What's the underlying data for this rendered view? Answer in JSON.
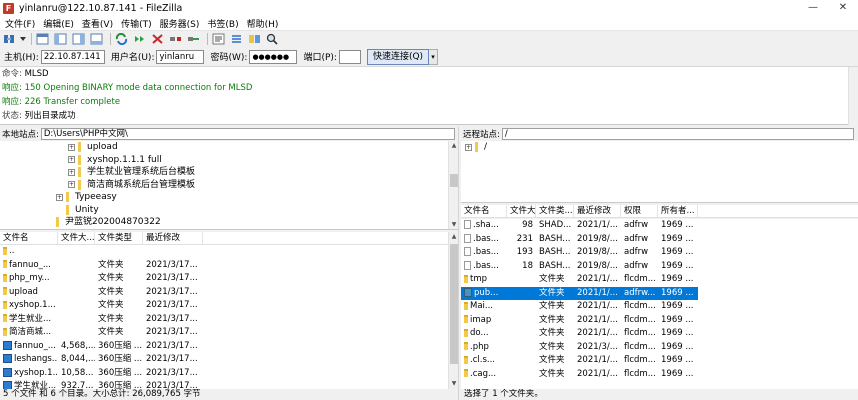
{
  "window": {
    "title": "yinlanru@122.10.87.141 - FileZilla",
    "app_icon_letter": "F",
    "controls": {
      "minimize": "—",
      "close": "✕"
    }
  },
  "menu": [
    "文件(F)",
    "编辑(E)",
    "查看(V)",
    "传输(T)",
    "服务器(S)",
    "书签(B)",
    "帮助(H)"
  ],
  "quickconnect": {
    "host_label": "主机(H):",
    "host_value": "22.10.87.141",
    "user_label": "用户名(U):",
    "user_value": "yinlanru",
    "pass_label": "密码(W):",
    "pass_value": "●●●●●●",
    "port_label": "端口(P):",
    "port_value": "",
    "button": "快速连接(Q)",
    "dropdown": "▾"
  },
  "log": [
    {
      "prefix": "命令:",
      "text": "MLSD",
      "color": "black"
    },
    {
      "prefix": "响应:",
      "text": "150 Opening BINARY mode data connection for MLSD",
      "color": "green"
    },
    {
      "prefix": "响应:",
      "text": "226 Transfer complete",
      "color": "green"
    },
    {
      "prefix": "状态:",
      "text": "列出目录成功",
      "color": "black"
    }
  ],
  "local": {
    "site_label": "本地站点:",
    "site_path": "D:\\Users\\PHP中文网\\",
    "tree": [
      {
        "label": "upload",
        "expander": "+"
      },
      {
        "label": "xyshop.1.1.1 full",
        "expander": "+"
      },
      {
        "label": "学生就业管理系统后台模板",
        "expander": "+"
      },
      {
        "label": "简洁商城系统后台管理模板",
        "expander": "+"
      },
      {
        "label": "Typeeasy",
        "expander": "+"
      },
      {
        "label": "Unity",
        "expander": ""
      },
      {
        "label": "尹蓝锐202004870322",
        "expander": ""
      }
    ],
    "columns": [
      "文件名",
      "文件大...",
      "文件类型",
      "最近修改"
    ],
    "rows": [
      {
        "icon": "fold",
        "name": "..",
        "size": "",
        "type": "",
        "modified": ""
      },
      {
        "icon": "fold",
        "name": "fannuo_...",
        "size": "",
        "type": "文件夹",
        "modified": "2021/3/17..."
      },
      {
        "icon": "fold",
        "name": "php_my...",
        "size": "",
        "type": "文件夹",
        "modified": "2021/3/17..."
      },
      {
        "icon": "fold",
        "name": "upload",
        "size": "",
        "type": "文件夹",
        "modified": "2021/3/17..."
      },
      {
        "icon": "fold",
        "name": "xyshop.1...",
        "size": "",
        "type": "文件夹",
        "modified": "2021/3/17..."
      },
      {
        "icon": "fold",
        "name": "学生就业...",
        "size": "",
        "type": "文件夹",
        "modified": "2021/3/17..."
      },
      {
        "icon": "fold",
        "name": "简洁商城...",
        "size": "",
        "type": "文件夹",
        "modified": "2021/3/17..."
      },
      {
        "icon": "zip",
        "name": "fannuo_...",
        "size": "4,568,...",
        "type": "360压缩 ...",
        "modified": "2021/3/17..."
      },
      {
        "icon": "zip",
        "name": "leshangs...",
        "size": "8,044,...",
        "type": "360压缩 ...",
        "modified": "2021/3/17..."
      },
      {
        "icon": "zip",
        "name": "xyshop.1...",
        "size": "10,58...",
        "type": "360压缩 ...",
        "modified": "2021/3/17..."
      },
      {
        "icon": "zip",
        "name": "学生就业...",
        "size": "932.7...",
        "type": "360压缩 ...",
        "modified": "2021/3/17..."
      }
    ],
    "status": "5 个文件 和 6 个目录。大小总计: 26,089,765 字节"
  },
  "remote": {
    "site_label": "远程站点:",
    "site_path": "/",
    "tree": [
      {
        "label": "/",
        "expander": "+"
      }
    ],
    "columns": [
      "文件名",
      "文件大...",
      "文件类...",
      "最近修改",
      "权限",
      "所有者..."
    ],
    "rows": [
      {
        "icon": "file",
        "name": ".sha...",
        "size": "98",
        "type": "SHAD...",
        "modified": "2021/1/...",
        "perms": "adfrw",
        "owner": "1969 ...",
        "selected": false
      },
      {
        "icon": "file",
        "name": ".bas...",
        "size": "231",
        "type": "BASH...",
        "modified": "2019/8/...",
        "perms": "adfrw",
        "owner": "1969 ...",
        "selected": false
      },
      {
        "icon": "file",
        "name": ".bas...",
        "size": "193",
        "type": "BASH...",
        "modified": "2019/8/...",
        "perms": "adfrw",
        "owner": "1969 ...",
        "selected": false
      },
      {
        "icon": "file",
        "name": ".bas...",
        "size": "18",
        "type": "BASH...",
        "modified": "2019/8/...",
        "perms": "adfrw",
        "owner": "1969 ...",
        "selected": false
      },
      {
        "icon": "fold",
        "name": "tmp",
        "size": "",
        "type": "文件夹",
        "modified": "2021/1/...",
        "perms": "flcdm...",
        "owner": "1969 ...",
        "selected": false
      },
      {
        "icon": "link",
        "name": "pub...",
        "size": "",
        "type": "文件夹",
        "modified": "2021/1/...",
        "perms": "adfrw...",
        "owner": "1969 ...",
        "selected": true
      },
      {
        "icon": "fold",
        "name": "Mai...",
        "size": "",
        "type": "文件夹",
        "modified": "2021/1/...",
        "perms": "flcdm...",
        "owner": "1969 ...",
        "selected": false
      },
      {
        "icon": "fold",
        "name": "imap",
        "size": "",
        "type": "文件夹",
        "modified": "2021/1/...",
        "perms": "flcdm...",
        "owner": "1969 ...",
        "selected": false
      },
      {
        "icon": "fold",
        "name": "do...",
        "size": "",
        "type": "文件夹",
        "modified": "2021/1/...",
        "perms": "flcdm...",
        "owner": "1969 ...",
        "selected": false
      },
      {
        "icon": "fold",
        "name": ".php",
        "size": "",
        "type": "文件夹",
        "modified": "2021/3/...",
        "perms": "flcdm...",
        "owner": "1969 ...",
        "selected": false
      },
      {
        "icon": "fold",
        "name": ".cl.s...",
        "size": "",
        "type": "文件夹",
        "modified": "2021/1/...",
        "perms": "flcdm...",
        "owner": "1969 ...",
        "selected": false
      },
      {
        "icon": "fold",
        "name": ".cag...",
        "size": "",
        "type": "文件夹",
        "modified": "2021/1/...",
        "perms": "flcdm...",
        "owner": "1969 ...",
        "selected": false
      }
    ],
    "status": "选择了 1 个文件夹。"
  },
  "toolbar_icons": [
    "site-manager-icon",
    "dropdown-icon",
    "toggle-log-icon",
    "toggle-local-tree-icon",
    "toggle-remote-tree-icon",
    "toggle-queue-icon",
    "refresh-icon",
    "process-queue-icon",
    "cancel-icon",
    "disconnect-icon",
    "reconnect-icon",
    "filter-icon",
    "compare-icon",
    "sync-browse-icon",
    "search-icon"
  ]
}
